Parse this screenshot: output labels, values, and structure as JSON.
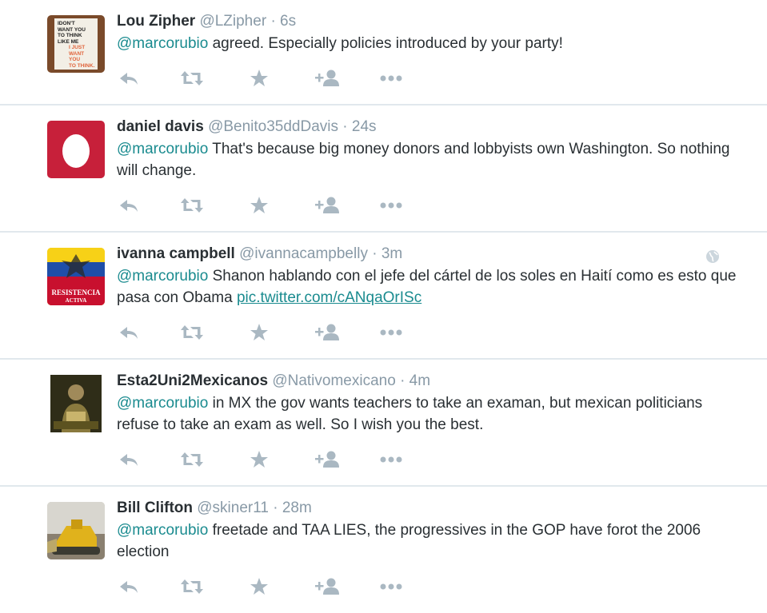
{
  "colors": {
    "name": "#292f33",
    "meta": "#8899a6",
    "mention": "#1a8b8f",
    "action_icon": "#aab8c2",
    "divider": "#e1e8ed"
  },
  "tweets": [
    {
      "name": "Lou Zipher",
      "handle": "@LZipher",
      "sep": "·",
      "time": "6s",
      "mention": "@marcorubio",
      "text": " agreed. Especially policies introduced by your party!",
      "link": "",
      "avatar_text": [
        "IDON'T",
        "WANT YOU",
        "TO THINK",
        "LIKE ME",
        "I JUST",
        "WANT YOU",
        "TO THINK."
      ]
    },
    {
      "name": "daniel davis",
      "handle": "@Benito35ddDavis",
      "sep": "·",
      "time": "24s",
      "mention": "@marcorubio",
      "text": " That's because big money donors and lobbyists own Washington. So nothing will change.",
      "link": ""
    },
    {
      "name": "ivanna campbell",
      "handle": "@ivannacampbelly",
      "sep": "·",
      "time": "3m",
      "mention": "@marcorubio",
      "text": " Shanon hablando con el jefe del cártel de los soles en Haití como es esto que pasa con Obama ",
      "link": "pic.twitter.com/cANqaOrISc",
      "avatar_text": [
        "RESISTENCIA",
        "ACTIVA"
      ]
    },
    {
      "name": "Esta2Uni2Mexicanos",
      "handle": "@Nativomexicano",
      "sep": "·",
      "time": "4m",
      "mention": "@marcorubio",
      "text": " in MX the gov wants teachers to take an examan, but mexican politicians refuse to take an exam as well. So I wish you the best.",
      "link": ""
    },
    {
      "name": "Bill Clifton",
      "handle": "@skiner11",
      "sep": "·",
      "time": "28m",
      "mention": "@marcorubio",
      "text": " freetade and TAA LIES,  the progressives in the GOP have forot the 2006 election",
      "link": ""
    }
  ]
}
